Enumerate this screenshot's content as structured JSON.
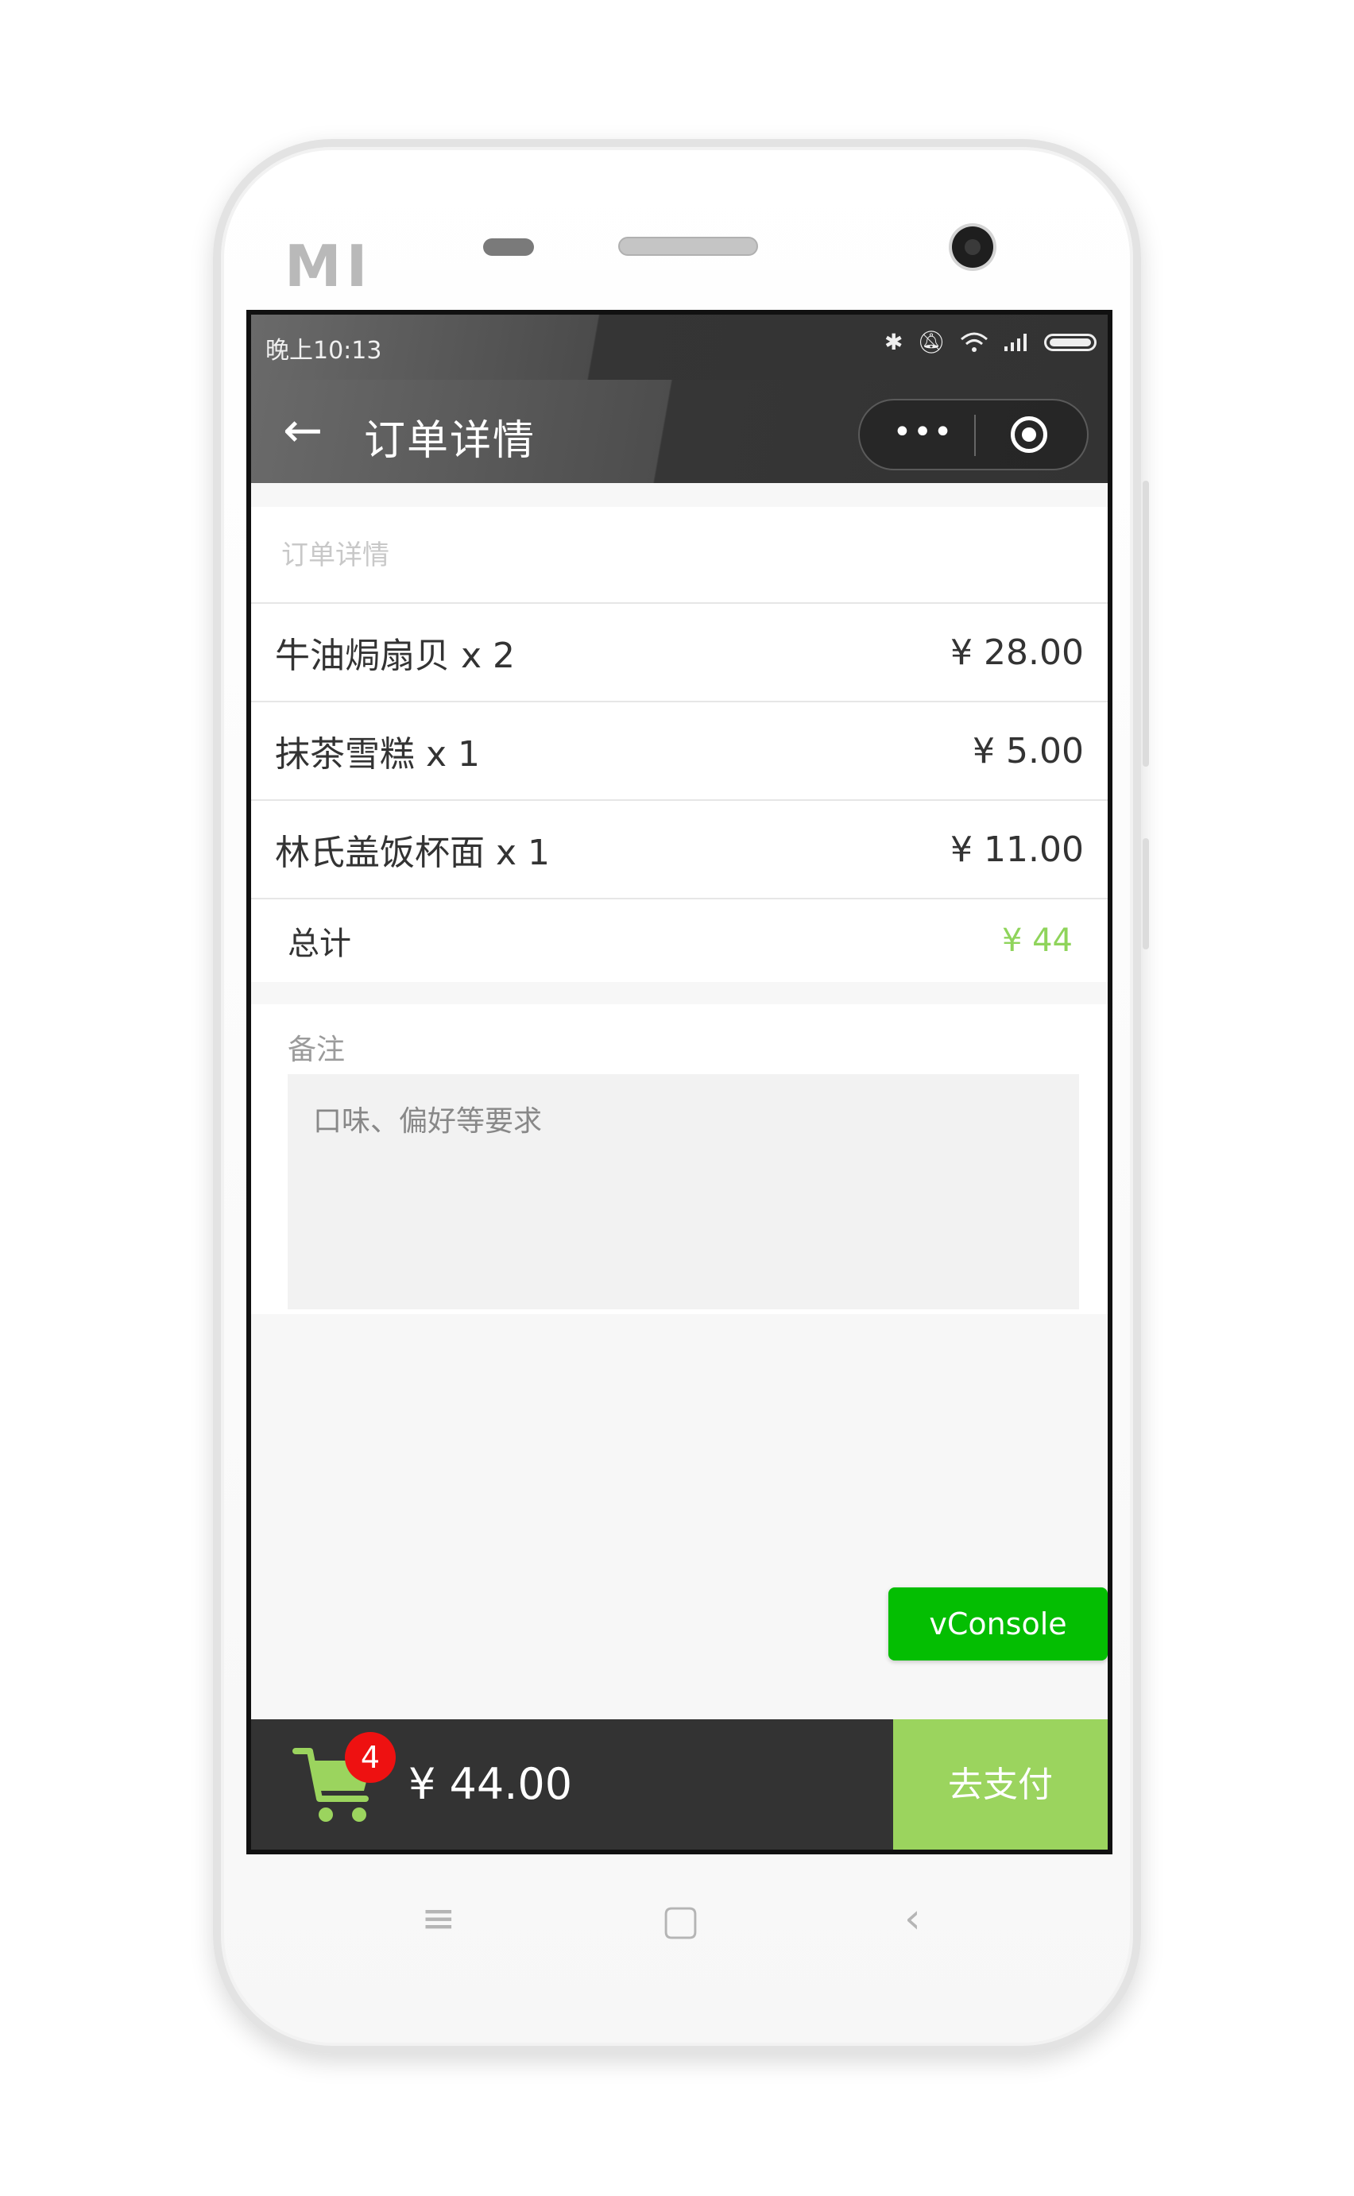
{
  "status_bar": {
    "time": "晚上10:13"
  },
  "nav_bar": {
    "title": "订单详情",
    "back_glyph": "←",
    "more_glyph": "•••"
  },
  "order": {
    "header": "订单详情",
    "items": [
      {
        "name": "牛油焗扇贝 x 2",
        "price": "¥ 28.00"
      },
      {
        "name": "抹茶雪糕 x 1",
        "price": "¥ 5.00"
      },
      {
        "name": "林氏盖饭杯面 x 1",
        "price": "¥ 11.00"
      }
    ],
    "total_label": "总计",
    "total_value": "¥ 44"
  },
  "note": {
    "label": "备注",
    "placeholder": "口味、偏好等要求"
  },
  "vconsole_label": "vConsole",
  "bottom_bar": {
    "cart_count": "4",
    "total": "¥ 44.00",
    "pay_label": "去支付"
  },
  "colors": {
    "accent_green": "#9bd45e",
    "vconsole_green": "#04be02",
    "badge_red": "#ee1111",
    "bar_dark": "#333333"
  },
  "icons": [
    "back-arrow-icon",
    "more-icon",
    "close-target-icon",
    "cart-icon",
    "bluetooth-icon",
    "mute-icon",
    "wifi-icon",
    "signal-icon",
    "battery-icon",
    "menu-key-icon",
    "home-key-icon",
    "back-key-icon"
  ]
}
